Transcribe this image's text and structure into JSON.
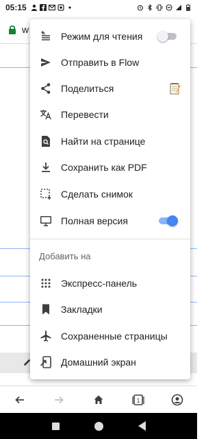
{
  "status_bar": {
    "time": "05:15"
  },
  "url_bar": {
    "text": "w"
  },
  "menu": {
    "items_top": [
      {
        "label": "Режим для чтения",
        "icon": "reader-mode-icon",
        "toggle": "off"
      },
      {
        "label": "Отправить в Flow",
        "icon": "send-icon"
      },
      {
        "label": "Поделиться",
        "icon": "share-icon",
        "trailing": "notepad-icon"
      },
      {
        "label": "Перевести",
        "icon": "translate-icon"
      },
      {
        "label": "Найти на странице",
        "icon": "find-in-page-icon"
      },
      {
        "label": "Сохранить как PDF",
        "icon": "download-icon"
      },
      {
        "label": "Сделать снимок",
        "icon": "screenshot-icon"
      },
      {
        "label": "Полная версия",
        "icon": "desktop-icon",
        "toggle": "on"
      }
    ],
    "section_header": "Добавить на",
    "items_bottom": [
      {
        "label": "Экспресс-панель",
        "icon": "speed-dial-icon"
      },
      {
        "label": "Закладки",
        "icon": "bookmark-icon"
      },
      {
        "label": "Сохраненные страницы",
        "icon": "airplane-icon"
      },
      {
        "label": "Домашний экран",
        "icon": "add-to-home-icon"
      }
    ]
  },
  "colors": {
    "accent": "#4285f4",
    "icon": "#5f6368",
    "text": "#202124"
  },
  "bottom_toolbar": {
    "tab_count": "1"
  }
}
